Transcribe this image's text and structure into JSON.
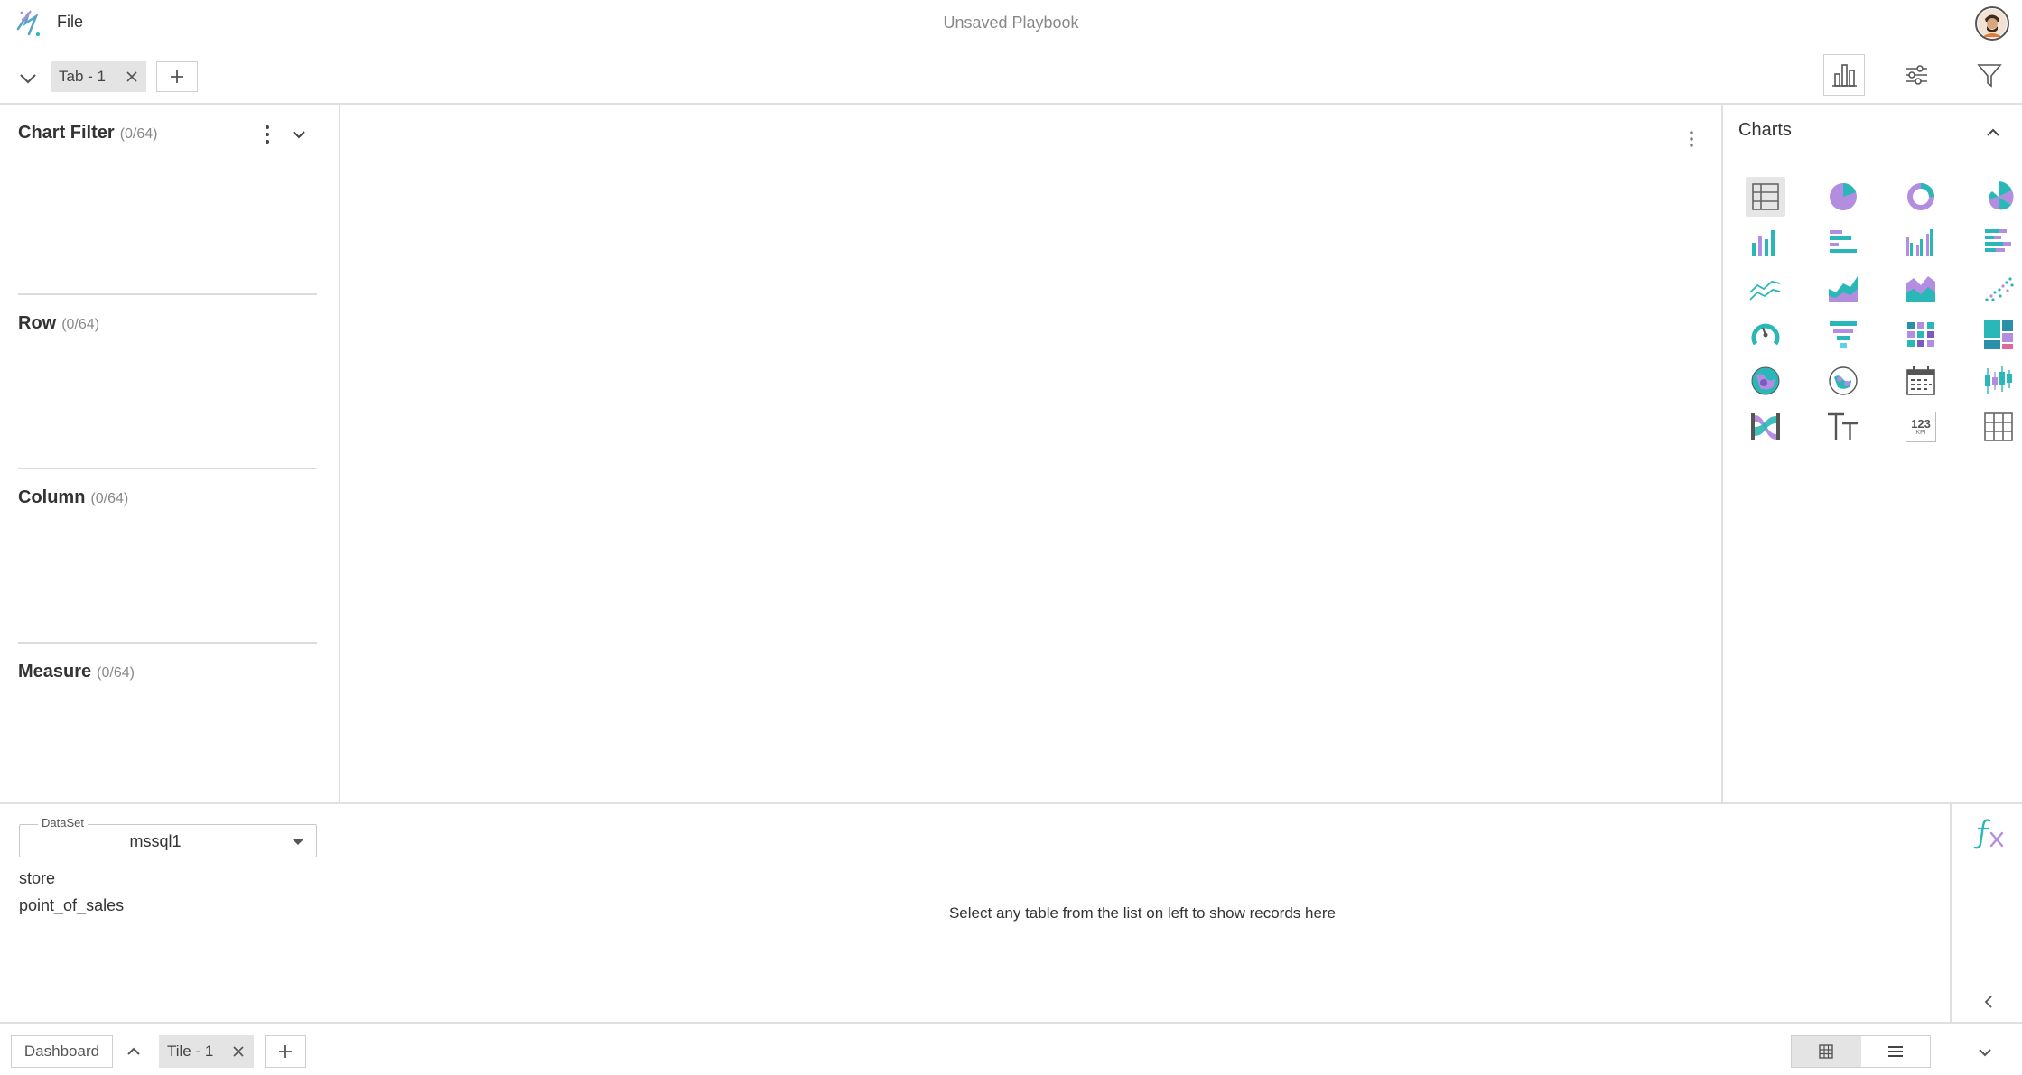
{
  "header": {
    "file_menu_label": "File",
    "title": "Unsaved Playbook",
    "logo_icon": "app-logo-icon",
    "avatar_icon": "user-avatar"
  },
  "tabs": {
    "items": [
      {
        "label": "Tab - 1"
      }
    ],
    "add_icon": "plus-icon",
    "collapse_icon": "chevron-down-icon"
  },
  "toolbar": {
    "icons": [
      "bar-chart-icon",
      "sliders-icon",
      "filter-icon"
    ]
  },
  "filter_pane": {
    "sections": [
      {
        "title": "Chart Filter",
        "count": "(0/64)"
      },
      {
        "title": "Row",
        "count": "(0/64)"
      },
      {
        "title": "Column",
        "count": "(0/64)"
      },
      {
        "title": "Measure",
        "count": "(0/64)"
      }
    ]
  },
  "charts_pane": {
    "title": "Charts",
    "icons": [
      "table-icon",
      "pie-chart-icon",
      "donut-chart-icon",
      "radial-chart-icon",
      "column-chart-icon",
      "bar-chart-horizontal-icon",
      "grouped-column-icon",
      "stacked-bar-icon",
      "line-chart-icon",
      "area-chart-icon",
      "stacked-area-icon",
      "scatter-chart-icon",
      "gauge-icon",
      "funnel-icon",
      "heatmap-icon",
      "treemap-icon",
      "map-bubble-icon",
      "map-globe-icon",
      "calendar-icon",
      "candlestick-icon",
      "sankey-icon",
      "text-icon",
      "kpi-icon",
      "pivot-grid-icon"
    ],
    "selected_index": 0,
    "kpi_text": "123",
    "kpi_sub": "KPI",
    "colors": {
      "purple": "#b38de0",
      "teal": "#2ab7b7",
      "gray": "#666666"
    }
  },
  "data_pane": {
    "dataset_label": "DataSet",
    "dataset_value": "mssql1",
    "tables": [
      "store",
      "point_of_sales"
    ],
    "empty_message": "Select any table from the list on left to show records here"
  },
  "footer": {
    "dashboard_label": "Dashboard",
    "tiles": [
      {
        "label": "Tile - 1"
      }
    ]
  }
}
